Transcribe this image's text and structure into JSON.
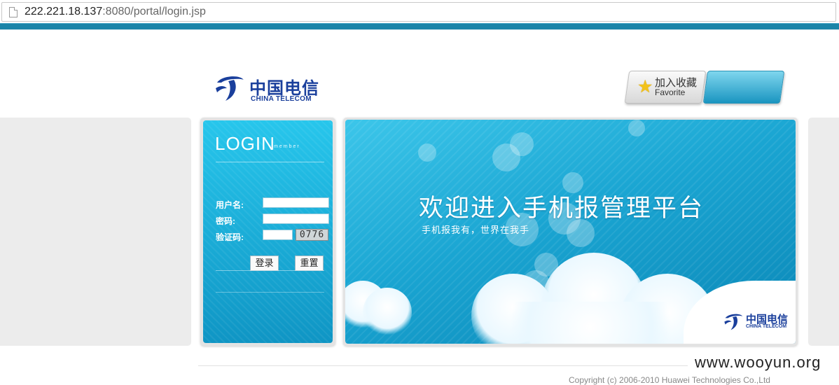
{
  "browser": {
    "url_host": "222.221.18.137",
    "url_rest": ":8080/portal/login.jsp"
  },
  "header": {
    "logo_cn": "中国电信",
    "logo_en": "CHINA TELECOM",
    "favorite_label": "加入收藏",
    "favorite_sublabel": "Favorite"
  },
  "login": {
    "title": "LOGIN",
    "subtitle": "member",
    "username_label": "用户名:",
    "username_value": "",
    "password_label": "密码:",
    "password_value": "",
    "captcha_label": "验证码:",
    "captcha_value": "",
    "captcha_image_text": "0776",
    "login_button": "登录",
    "reset_button": "重置"
  },
  "banner": {
    "title": "欢迎进入手机报管理平台",
    "subtitle": "手机报我有，世界在我手",
    "logo_cn": "中国电信",
    "logo_en": "CHINA TELECOM"
  },
  "footer": {
    "copyright": "Copyright (c) 2006-2010 Huawei Technologies Co.,Ltd"
  },
  "watermark": "www.wooyun.org",
  "colors": {
    "accent": "#1a84a8",
    "brand": "#1a3f9c",
    "panel": "#1aa5d2"
  }
}
